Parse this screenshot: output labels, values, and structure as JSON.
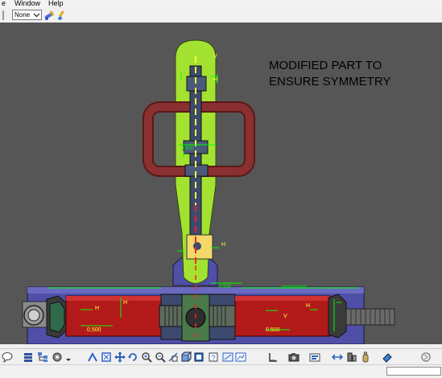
{
  "menubar": {
    "items": [
      "e",
      "Window",
      "Help"
    ]
  },
  "toolbar": {
    "dropdown_value": "None",
    "icons": [
      "format-painter-icon",
      "paint-brush-icon"
    ]
  },
  "viewport": {
    "annotation": "MODIFIED PART TO\nENSURE SYMMETRY",
    "background": "#565656",
    "colors": {
      "lever": "#a4e232",
      "handle": "#7b2d2a",
      "rod": "#3d4a6e",
      "base": "#4f4fa8",
      "cylinder": "#b21a1a",
      "screw": "#5c6b5c",
      "axis_yellow": "#ffff3c",
      "axis_red": "#ff2020",
      "dimension": "#00ff00"
    }
  },
  "bottom_toolbar": {
    "icons": [
      "speech-bubble-icon",
      "layers-icon",
      "tree-icon",
      "gear-icon",
      "dropdown-arrow-icon",
      "move-icon",
      "fit-all-icon",
      "pan-icon",
      "rotate-icon",
      "zoom-in-icon",
      "zoom-out-icon",
      "normal-view-icon",
      "cube-view-icon",
      "view-mode-icon",
      "hide-show-icon",
      "swap-icon",
      "chart-icon",
      "ruler-icon",
      "camera-icon",
      "catalog-icon",
      "sheet-icon",
      "plane-icon",
      "bottle-icon",
      "eraser-icon",
      "refresh-icon"
    ]
  }
}
